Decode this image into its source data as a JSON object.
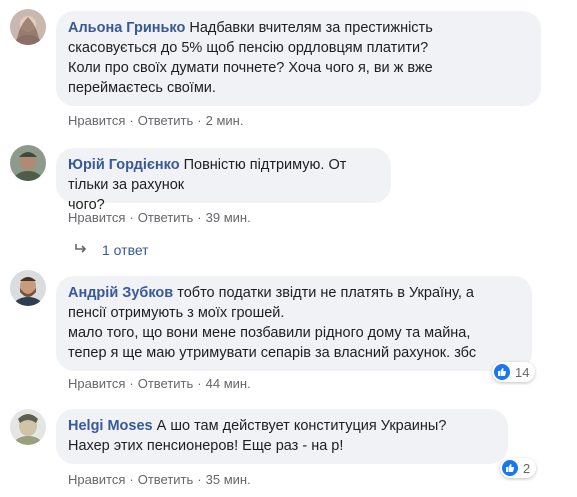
{
  "comments": [
    {
      "author": "Альона Гринько",
      "text": "Надбавки вчителям за престижність\nскасовується до 5% щоб пенсію ордловцям платити?\nКоли про своїх думати почнете? Хоча чого я, ви ж вже\nпереймаєтесь своїми.",
      "like_label": "Нравится",
      "reply_label": "Ответить",
      "time": "2 мин."
    },
    {
      "author": "Юрій Гордієнко",
      "text": "Повністю підтримую. От тільки за рахунок\nчого?",
      "like_label": "Нравится",
      "reply_label": "Ответить",
      "time": "39 мин.",
      "replies_label": "1 ответ"
    },
    {
      "author": "Андрій Зубков",
      "text": "тобто податки звідти не платять в Україну, а\nпенсії отримують з моїх грошей.\nмало того, що вони мене позбавили рідного дому та майна,\nтепер я ще маю утримувати сепарів за власний рахунок. збс",
      "like_label": "Нравится",
      "reply_label": "Ответить",
      "time": "44 мин.",
      "reaction_count": "14"
    },
    {
      "author": "Helgi Moses",
      "text": "А шо там действует конституция Украины?\nНахер этих пенсионеров! Еще раз - на  р!",
      "like_label": "Нравится",
      "reply_label": "Ответить",
      "time": "35 мин.",
      "reaction_count": "2"
    }
  ],
  "colors": {
    "author": "#385898",
    "bubble": "#f0f2f5",
    "like": "#1877f2",
    "meta": "#65676b"
  }
}
